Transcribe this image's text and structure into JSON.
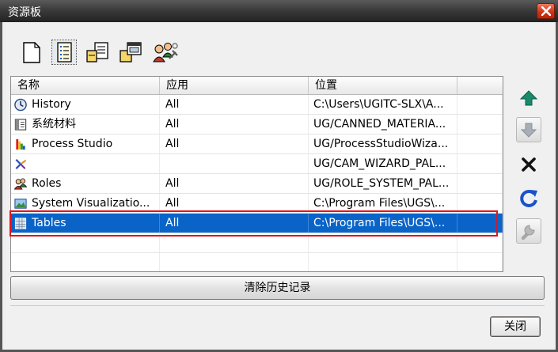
{
  "window": {
    "title": "资源板"
  },
  "toolbar": {
    "icons": [
      "new-page-icon",
      "list-details-icon",
      "tree-list-icon",
      "palette-window-icon",
      "roles-settings-icon"
    ]
  },
  "table": {
    "columns": [
      "名称",
      "应用",
      "位置"
    ],
    "rows": [
      {
        "name": "History",
        "app": "All",
        "location": "C:\\Users\\UGITC-SLX\\A...",
        "icon": "clock-icon"
      },
      {
        "name": "系统材料",
        "app": "All",
        "location": "UG/CANNED_MATERIA...",
        "icon": "material-icon"
      },
      {
        "name": "Process Studio",
        "app": "All",
        "location": "UG/ProcessStudioWiza...",
        "icon": "process-studio-icon"
      },
      {
        "name": "",
        "app": "",
        "location": "UG/CAM_WIZARD_PAL...",
        "icon": "cam-wizard-icon"
      },
      {
        "name": "Roles",
        "app": "All",
        "location": "UG/ROLE_SYSTEM_PAL...",
        "icon": "roles-icon"
      },
      {
        "name": "System Visualizatio...",
        "app": "All",
        "location": "C:\\Program Files\\UGS\\...",
        "icon": "visualization-icon"
      },
      {
        "name": "Tables",
        "app": "All",
        "location": "C:\\Program Files\\UGS\\...",
        "icon": "table-icon",
        "selected": true
      }
    ]
  },
  "side_buttons": [
    "move-up-icon",
    "move-down-icon",
    "delete-icon",
    "refresh-icon",
    "wrench-icon"
  ],
  "buttons": {
    "clear_history": "清除历史记录",
    "close": "关闭"
  },
  "colors": {
    "selection": "#0a64c8",
    "highlight_box": "#e0141e",
    "accent_green": "#1a8a6a"
  }
}
